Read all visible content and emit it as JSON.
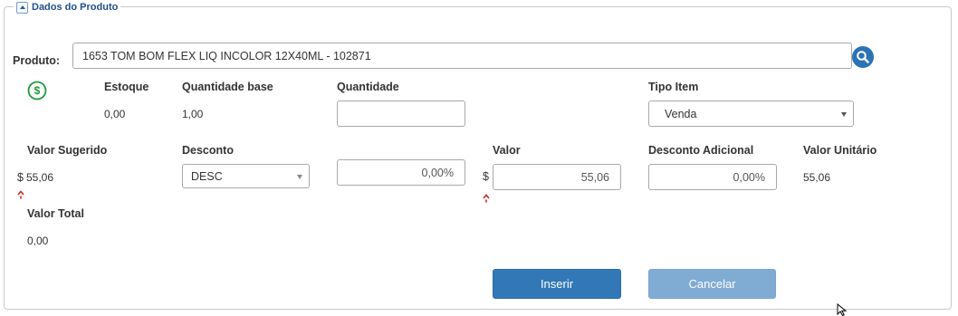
{
  "section": {
    "title": "Dados do Produto"
  },
  "produto": {
    "label": "Produto:",
    "value": "1653 TOM BOM FLEX LIQ INCOLOR 12X40ML - 102871"
  },
  "estoque": {
    "label": "Estoque",
    "value": "0,00"
  },
  "quantidade_base": {
    "label": "Quantidade base",
    "value": "1,00"
  },
  "quantidade": {
    "label": "Quantidade",
    "value": ""
  },
  "tipo_item": {
    "label": "Tipo Item",
    "selected": "Venda"
  },
  "valor_sugerido": {
    "label": "Valor Sugerido",
    "currency": "$",
    "value": "55,06"
  },
  "desconto": {
    "label": "Desconto",
    "selected": "DESC",
    "percent": "0,00%"
  },
  "valor": {
    "label": "Valor",
    "currency": "$",
    "value": "55,06"
  },
  "desconto_adicional": {
    "label": "Desconto Adicional",
    "value": "0,00%"
  },
  "valor_unitario": {
    "label": "Valor Unitário",
    "value": "55,06"
  },
  "valor_total": {
    "label": "Valor Total",
    "value": "0,00"
  },
  "buttons": {
    "inserir": "Inserir",
    "cancelar": "Cancelar"
  },
  "colors": {
    "primary": "#3278b6",
    "disabled": "#80abd3",
    "money_icon": "#1a9a3a",
    "search_icon": "#2a73b7",
    "warning_arrow": "#d42020"
  },
  "icons": {
    "money": "dollar-circle-icon",
    "search": "magnifier-icon",
    "warning": "up-arrow-icon"
  }
}
